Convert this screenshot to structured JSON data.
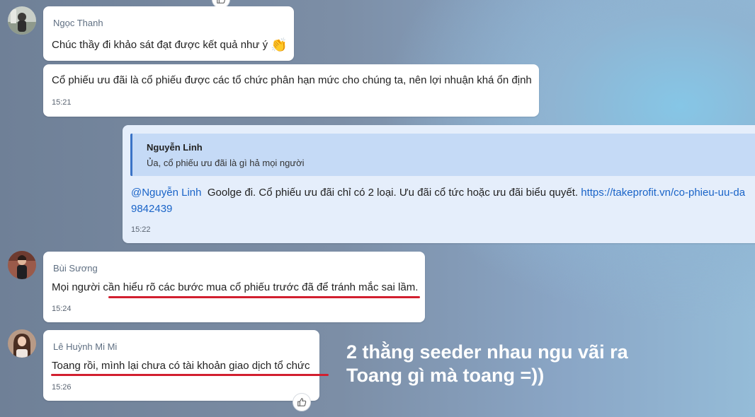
{
  "messages": [
    {
      "sender": "Ngọc Thanh",
      "text": "Chúc thầy đi khảo sát đạt được kết quả như ý",
      "emoji": "👏"
    },
    {
      "text": "Cổ phiếu ưu đãi là cổ phiếu được các tổ chức phân hạn mức cho chúng ta, nên lợi nhuận khá ổn định",
      "time": "15:21"
    },
    {
      "quote_sender": "Nguyễn Linh",
      "quote_text": "Ủa, cổ phiếu ưu đãi là gì hả mọi người",
      "mention": "@Nguyễn Linh",
      "text": "Goolge đi. Cổ phiếu ưu đãi chỉ có 2 loại. Ưu đãi cổ tức hoặc ưu đãi biểu quyết.",
      "link_line1": "https://takeprofit.vn/co-phieu-uu-da",
      "link_line2": "9842439",
      "time": "15:22"
    },
    {
      "sender": "Bùi Sương",
      "text": "Mọi người cần hiểu rõ các bước mua cổ phiếu trước đã để tránh mắc sai lầm.",
      "time": "15:24"
    },
    {
      "sender": "Lê Huỳnh Mi Mi",
      "text": "Toang rồi, mình lại chưa có tài khoản giao dịch tổ chức",
      "time": "15:26"
    }
  ],
  "overlay": {
    "line1": "2 thằng seeder nhau ngu vãi ra",
    "line2": "Toang gì mà toang =))"
  },
  "icons": {
    "reaction": "thumbs-up-icon"
  },
  "colors": {
    "link": "#1a64c8",
    "quote_border": "#3b73c6",
    "annotation": "#d21f2f"
  }
}
